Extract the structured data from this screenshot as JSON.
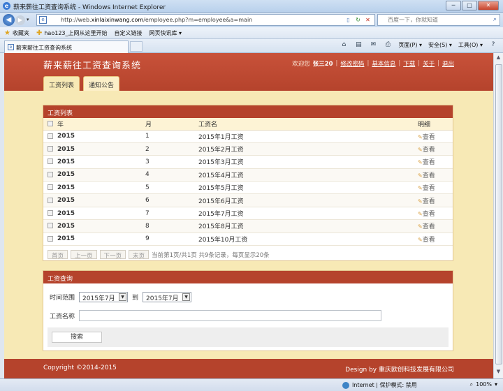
{
  "window": {
    "title": "薪来薪往工资查询系统 - Windows Internet Explorer",
    "buttons": [
      "─",
      "□",
      "✕"
    ]
  },
  "browser": {
    "url_prefix": "http://web.",
    "url_domain": "xinlaixinwang.com",
    "url_rest": "/employee.php?m=employee&a=main",
    "search_placeholder": "百度一下，你就知道",
    "favorites": {
      "label": "收藏夹",
      "items": [
        "hao123_上网从这里开始",
        "自定义链接",
        "网页快讯库 ▾"
      ]
    },
    "tab_title": "薪来薪往工资查询系统",
    "commands": [
      "页面(P) ▾",
      "安全(S) ▾",
      "工具(O) ▾"
    ],
    "status": {
      "zone": "Internet | 保护模式: 禁用",
      "zoom": "100%"
    }
  },
  "header": {
    "site_title": "薪来薪往工资查询系统",
    "welcome": "欢迎您",
    "username": "张三20",
    "links": [
      "修改密码",
      "基本信息",
      "下载",
      "关于",
      "退出"
    ]
  },
  "nav_tabs": [
    "工资列表",
    "通知公告"
  ],
  "salary_panel": {
    "title": "工资列表",
    "columns": [
      "年",
      "月",
      "工资名",
      "明细"
    ],
    "view_label": "查看",
    "rows": [
      {
        "year": "2015",
        "month": "1",
        "name": "2015年1月工资"
      },
      {
        "year": "2015",
        "month": "2",
        "name": "2015年2月工资"
      },
      {
        "year": "2015",
        "month": "3",
        "name": "2015年3月工资"
      },
      {
        "year": "2015",
        "month": "4",
        "name": "2015年4月工资"
      },
      {
        "year": "2015",
        "month": "5",
        "name": "2015年5月工资"
      },
      {
        "year": "2015",
        "month": "6",
        "name": "2015年6月工资"
      },
      {
        "year": "2015",
        "month": "7",
        "name": "2015年7月工资"
      },
      {
        "year": "2015",
        "month": "8",
        "name": "2015年8月工资"
      },
      {
        "year": "2015",
        "month": "9",
        "name": "2015年10月工资"
      }
    ],
    "pager": {
      "first": "首页",
      "prev": "上一页",
      "next": "下一页",
      "last": "末页",
      "info": "当前第1页/共1页  共9条记录，每页显示20条"
    }
  },
  "query_panel": {
    "title": "工资查询",
    "range_label": "时间范围",
    "from_value": "2015年7月",
    "to_label": "到",
    "to_value": "2015年7月",
    "name_label": "工资名称",
    "name_value": "",
    "search_button": "搜索"
  },
  "footer": {
    "copyright": "Copyright ©2014-2015",
    "design": "Design by 重庆欧创科技发展有限公司"
  }
}
